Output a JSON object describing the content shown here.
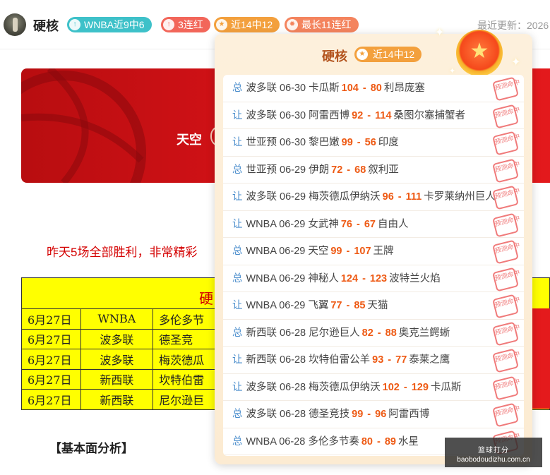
{
  "header": {
    "user_name": "硬核",
    "badges": [
      {
        "text": "WNBA近9中6",
        "icon": "arrow-up-icon"
      },
      {
        "text": "3连红",
        "icon": "arrow-up-icon"
      },
      {
        "text": "近14中12",
        "icon": "star-icon"
      },
      {
        "text": "最长11连红",
        "icon": "flame-icon"
      }
    ],
    "update_label": "最近更新：2026"
  },
  "article": {
    "banner_team": "天空",
    "intro": "昨天5场全部胜利，非常精彩",
    "table_title": "硬",
    "rows": [
      {
        "date": "6月27日",
        "league": "WNBA",
        "match": "多伦多节"
      },
      {
        "date": "6月27日",
        "league": "波多联",
        "match": "德圣竞"
      },
      {
        "date": "6月27日",
        "league": "波多联",
        "match": "梅茨德瓜"
      },
      {
        "date": "6月27日",
        "league": "新西联",
        "match": "坎特伯雷"
      },
      {
        "date": "6月27日",
        "league": "新西联",
        "match": "尼尔逊巨"
      }
    ],
    "section_heading": "【基本面分析】"
  },
  "popup": {
    "name": "硬核",
    "badge": "近14中12",
    "stamp_text": "预测命中",
    "records": [
      {
        "tag": "总",
        "league": "波多联",
        "date": "06-30",
        "home": "卡瓜斯",
        "home_score": "104",
        "away_score": "80",
        "away": "利昂庞塞"
      },
      {
        "tag": "让",
        "league": "波多联",
        "date": "06-30",
        "home": "阿雷西博",
        "home_score": "92",
        "away_score": "114",
        "away": "桑图尔塞捕蟹者"
      },
      {
        "tag": "让",
        "league": "世亚预",
        "date": "06-30",
        "home": "黎巴嫩",
        "home_score": "99",
        "away_score": "56",
        "away": "印度"
      },
      {
        "tag": "总",
        "league": "世亚预",
        "date": "06-29",
        "home": "伊朗",
        "home_score": "72",
        "away_score": "68",
        "away": "叙利亚"
      },
      {
        "tag": "让",
        "league": "波多联",
        "date": "06-29",
        "home": "梅茨德瓜伊纳沃",
        "home_score": "96",
        "away_score": "111",
        "away": "卡罗莱纳州巨人"
      },
      {
        "tag": "让",
        "league": "WNBA",
        "date": "06-29",
        "home": "女武神",
        "home_score": "76",
        "away_score": "67",
        "away": "自由人"
      },
      {
        "tag": "总",
        "league": "WNBA",
        "date": "06-29",
        "home": "天空",
        "home_score": "99",
        "away_score": "107",
        "away": "王牌"
      },
      {
        "tag": "总",
        "league": "WNBA",
        "date": "06-29",
        "home": "神秘人",
        "home_score": "124",
        "away_score": "123",
        "away": "波特兰火焰"
      },
      {
        "tag": "让",
        "league": "WNBA",
        "date": "06-29",
        "home": "飞翼",
        "home_score": "77",
        "away_score": "85",
        "away": "天猫"
      },
      {
        "tag": "总",
        "league": "新西联",
        "date": "06-28",
        "home": "尼尔逊巨人",
        "home_score": "82",
        "away_score": "88",
        "away": "奥克兰鳄蜥"
      },
      {
        "tag": "让",
        "league": "新西联",
        "date": "06-28",
        "home": "坎特伯雷公羊",
        "home_score": "93",
        "away_score": "77",
        "away": "泰莱之鹰"
      },
      {
        "tag": "让",
        "league": "波多联",
        "date": "06-28",
        "home": "梅茨德瓜伊纳沃",
        "home_score": "102",
        "away_score": "129",
        "away": "卡瓜斯"
      },
      {
        "tag": "总",
        "league": "波多联",
        "date": "06-28",
        "home": "德圣竞技",
        "home_score": "99",
        "away_score": "96",
        "away": "阿雷西博"
      },
      {
        "tag": "总",
        "league": "WNBA",
        "date": "06-28",
        "home": "多伦多节奏",
        "home_score": "80",
        "away_score": "89",
        "away": "水星"
      }
    ]
  },
  "watermark": {
    "top": "篮球打分",
    "bottom": "baobodoudizhu.com.cn"
  },
  "colors": {
    "accent_orange": "#ee5a14",
    "tag_blue": "#4a8dcc",
    "stamp_red": "#f07a7a"
  }
}
